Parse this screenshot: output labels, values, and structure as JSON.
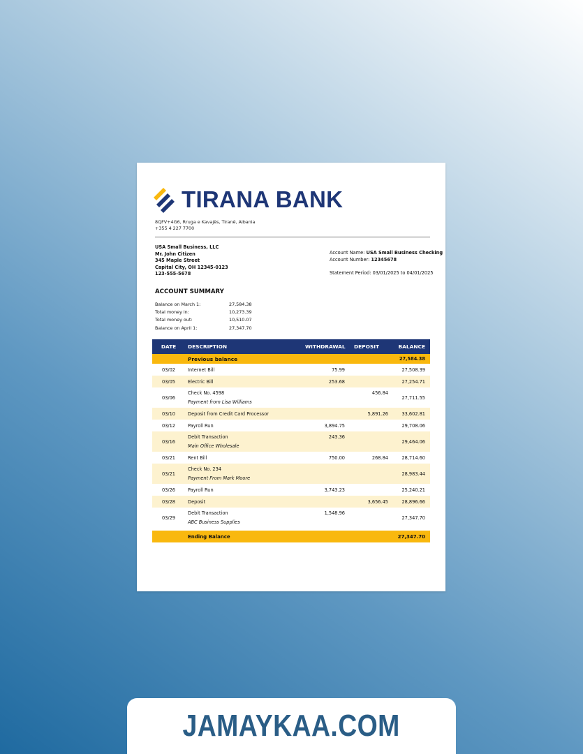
{
  "bank": {
    "name": "TIRANA BANK",
    "address": "8QFV+4G6, Rruga e Kavajës, Tiranë, Albania",
    "phone": "+355 4 227 7700",
    "colors": {
      "navy": "#1e3676",
      "gold": "#f9b80e",
      "shade": "#fdf2cf"
    }
  },
  "customer": {
    "company": "USA Small Business, LLC",
    "name": "Mr. John Citizen",
    "street": "345 Maple Street",
    "city": "Capital City, OH 12345-0123",
    "phone": "123-555-5678"
  },
  "account": {
    "name_label": "Account Name:",
    "name_value": "USA Small Business Checking",
    "number_label": "Account Number:",
    "number_value": "12345678",
    "period": "Statement Period: 03/01/2025 to 04/01/2025"
  },
  "summary": {
    "title": "ACCOUNT SUMMARY",
    "rows": [
      {
        "label": "Balance on March 1:",
        "value": "27,584.38"
      },
      {
        "label": "Total money in:",
        "value": "10,273.39"
      },
      {
        "label": "Total money out:",
        "value": "10,510.07"
      },
      {
        "label": "Balance on April 1:",
        "value": "27,347.70"
      }
    ]
  },
  "table": {
    "headers": {
      "date": "DATE",
      "description": "DESCRIPTION",
      "withdrawal": "WITHDRAWAL",
      "deposit": "DEPOSIT",
      "balance": "BALANCE"
    },
    "previous": {
      "label": "Previous balance",
      "balance": "27,584.38"
    },
    "rows": [
      {
        "date": "03/02",
        "desc": "Internet Bill",
        "sub": "",
        "withdrawal": "75.99",
        "deposit": "",
        "balance": "27,508.39"
      },
      {
        "date": "03/05",
        "desc": "Electric Bill",
        "sub": "",
        "withdrawal": "253.68",
        "deposit": "",
        "balance": "27,254.71"
      },
      {
        "date": "03/06",
        "desc": "Check No. 4598",
        "sub": "Payment from Lisa Williams",
        "withdrawal": "",
        "deposit": "456.84",
        "balance": "27,711.55"
      },
      {
        "date": "03/10",
        "desc": "Deposit from Credit Card Processor",
        "sub": "",
        "withdrawal": "",
        "deposit": "5,891.26",
        "balance": "33,602.81"
      },
      {
        "date": "03/12",
        "desc": "Payroll Run",
        "sub": "",
        "withdrawal": "3,894.75",
        "deposit": "",
        "balance": "29,708.06"
      },
      {
        "date": "03/16",
        "desc": "Debit Transaction",
        "sub": "Main Office Wholesale",
        "withdrawal": "243.36",
        "deposit": "",
        "balance": "29,464.06"
      },
      {
        "date": "03/21",
        "desc": "Rent Bill",
        "sub": "",
        "withdrawal": "750.00",
        "deposit": "268.84",
        "balance": "28,714.60"
      },
      {
        "date": "03/21",
        "desc": "Check No. 234",
        "sub": "Payment From Mark Moore",
        "withdrawal": "",
        "deposit": "",
        "balance": "28,983.44"
      },
      {
        "date": "03/26",
        "desc": "Payroll Run",
        "sub": "",
        "withdrawal": "3,743.23",
        "deposit": "",
        "balance": "25,240.21"
      },
      {
        "date": "03/28",
        "desc": "Deposit",
        "sub": "",
        "withdrawal": "",
        "deposit": "3,656.45",
        "balance": "28,896.66"
      },
      {
        "date": "03/29",
        "desc": "Debit Transaction",
        "sub": "ABC Business Supplies",
        "withdrawal": "1,548.96",
        "deposit": "",
        "balance": "27,347.70"
      }
    ],
    "ending": {
      "label": "Ending Balance",
      "balance": "27,347.70"
    }
  },
  "watermark": "JAMAYKAA.COM"
}
